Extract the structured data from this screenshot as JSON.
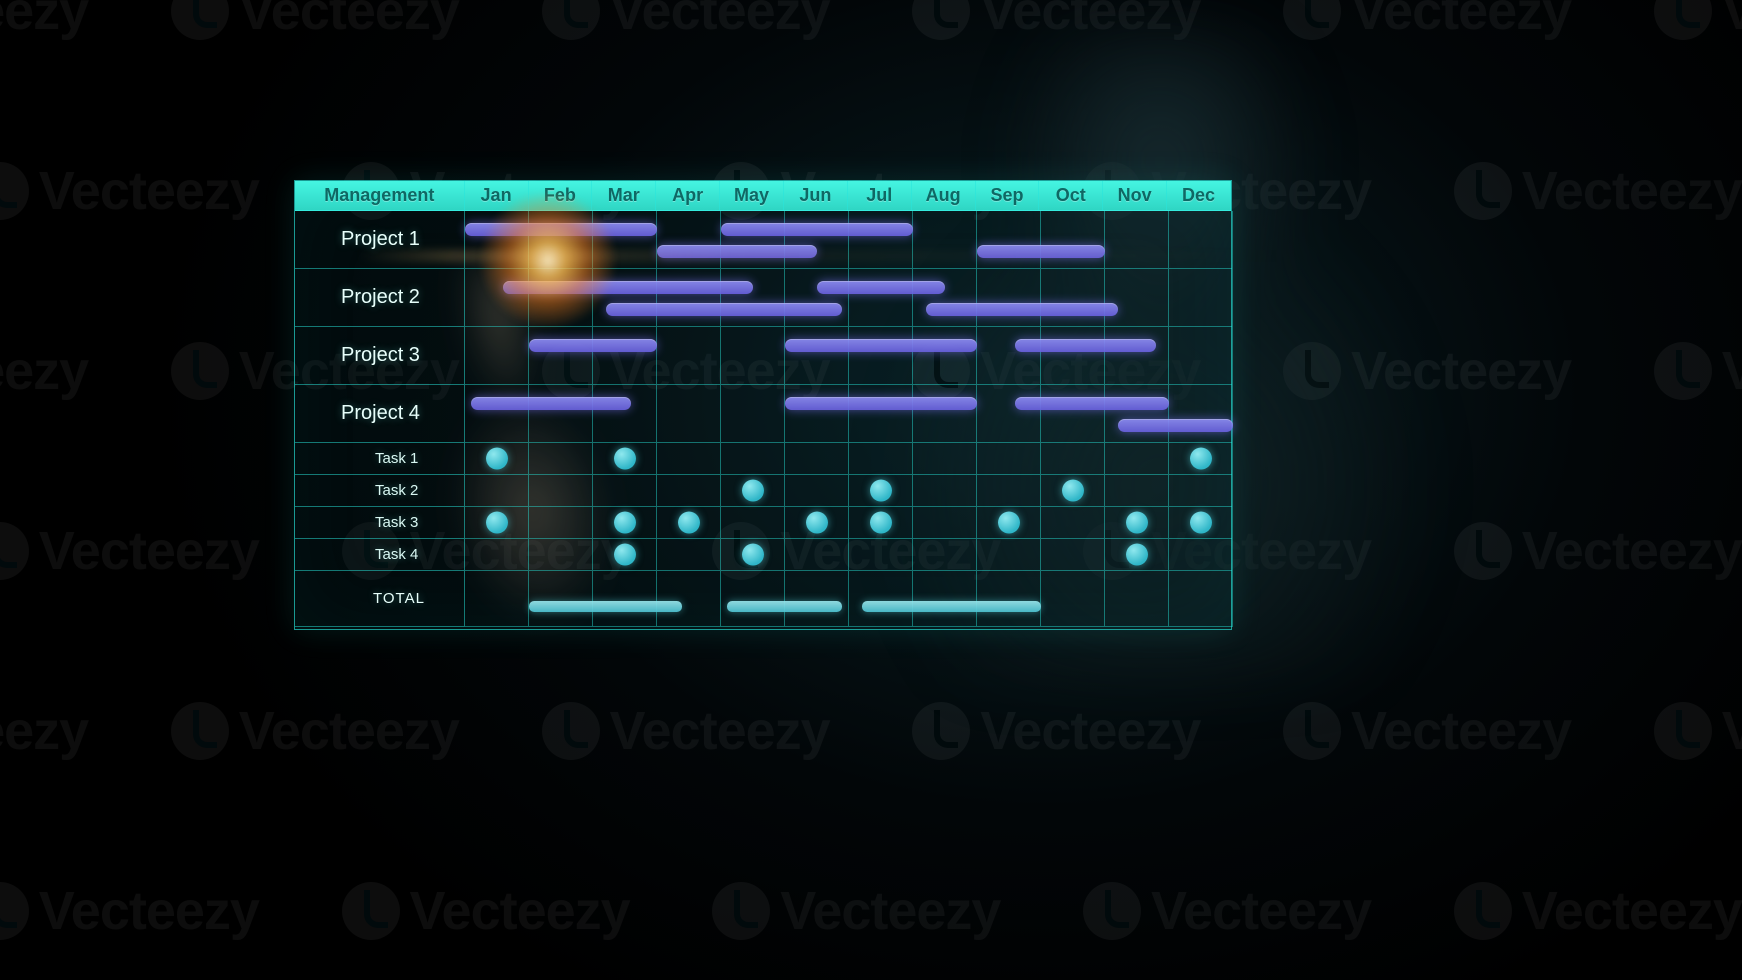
{
  "watermark_text": "Vecteezy",
  "chart_data": {
    "type": "gantt",
    "title": "Management",
    "months": [
      "Jan",
      "Feb",
      "Mar",
      "Apr",
      "May",
      "Jun",
      "Jul",
      "Aug",
      "Sep",
      "Oct",
      "Nov",
      "Dec"
    ],
    "projects": [
      {
        "name": "Project 1",
        "bars": [
          {
            "start": 0,
            "end": 3,
            "row": 0
          },
          {
            "start": 4,
            "end": 7,
            "row": 0
          },
          {
            "start": 3,
            "end": 5.5,
            "row": 1
          },
          {
            "start": 8,
            "end": 10,
            "row": 1
          }
        ]
      },
      {
        "name": "Project 2",
        "bars": [
          {
            "start": 0.6,
            "end": 4.5,
            "row": 0
          },
          {
            "start": 5.5,
            "end": 7.5,
            "row": 0
          },
          {
            "start": 2.2,
            "end": 5.9,
            "row": 1
          },
          {
            "start": 7.2,
            "end": 10.2,
            "row": 1
          }
        ]
      },
      {
        "name": "Project 3",
        "bars": [
          {
            "start": 1,
            "end": 3,
            "row": 0
          },
          {
            "start": 5,
            "end": 8,
            "row": 0
          },
          {
            "start": 8.6,
            "end": 10.8,
            "row": 0
          }
        ]
      },
      {
        "name": "Project 4",
        "bars": [
          {
            "start": 0.1,
            "end": 2.6,
            "row": 0
          },
          {
            "start": 5,
            "end": 8,
            "row": 0
          },
          {
            "start": 8.6,
            "end": 11,
            "row": 0
          },
          {
            "start": 10.2,
            "end": 12,
            "row": 1
          }
        ]
      }
    ],
    "tasks": [
      {
        "name": "Task 1",
        "months": [
          "Jan",
          "Mar",
          "Dec"
        ]
      },
      {
        "name": "Task 2",
        "months": [
          "May",
          "Jul",
          "Oct"
        ]
      },
      {
        "name": "Task 3",
        "months": [
          "Jan",
          "Mar",
          "Apr",
          "Jun",
          "Jul",
          "Sep",
          "Nov",
          "Dec"
        ]
      },
      {
        "name": "Task 4",
        "months": [
          "Mar",
          "May",
          "Nov"
        ]
      }
    ],
    "total": {
      "name": "TOTAL",
      "segments": [
        {
          "start": 1,
          "end": 3.4
        },
        {
          "start": 4.1,
          "end": 5.9
        },
        {
          "start": 6.2,
          "end": 9
        }
      ]
    }
  }
}
